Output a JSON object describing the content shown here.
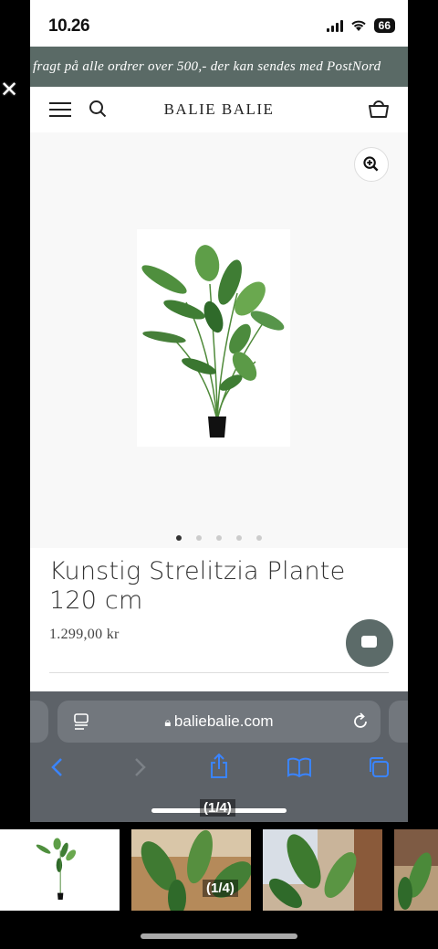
{
  "status_bar": {
    "time": "10.26",
    "battery": "66"
  },
  "banner": {
    "text": "fragt på alle ordrer over 500,- der kan sendes med PostNord"
  },
  "header": {
    "brand": "BALIE BALIE"
  },
  "gallery": {
    "current_index": 1,
    "total_dots": 5
  },
  "product": {
    "title": "Kunstig Strelitzia Plante 120 cm",
    "price": "1.299,00 kr"
  },
  "browser": {
    "url": "baliebalie.com"
  },
  "viewer": {
    "counter": "(1/4)"
  },
  "icons": [
    "menu-icon",
    "search-icon",
    "basket-icon",
    "zoom-in-icon",
    "chat-icon",
    "lock-icon",
    "reader-icon",
    "reload-icon",
    "back-icon",
    "forward-icon",
    "share-icon",
    "bookmarks-icon",
    "tabs-icon",
    "close-icon"
  ],
  "colors": {
    "banner_bg": "#5a6a66",
    "chat_bg": "#5c6b69",
    "safari_accent": "#3a84ff"
  }
}
